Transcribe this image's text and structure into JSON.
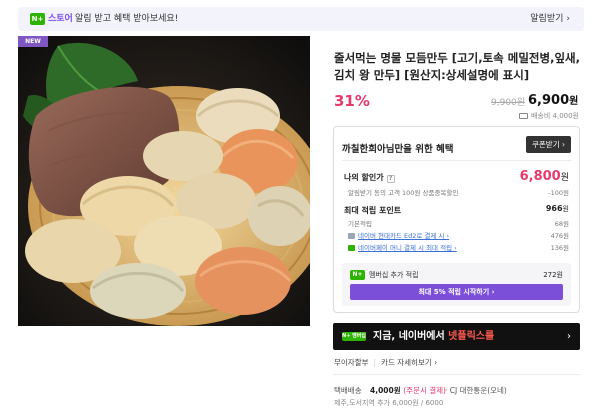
{
  "notice": {
    "badge": "N+",
    "store": "스토어",
    "message": "알림 받고 혜택 받아보세요!",
    "button": "알림받기",
    "chevron": "›"
  },
  "product": {
    "new_tag": "NEW",
    "title": "줄서먹는 명물 모듬만두 [고기,토속 메밀전병,잎새,김치 왕 만두] [원산지:상세설명에 표시]",
    "discount": "31%",
    "original_price": "9,900원",
    "price": "6,900",
    "price_unit": "원",
    "shipping": "배송비 4,000원"
  },
  "benefits": {
    "heading": "까칠한희아님만을 위한 혜택",
    "coupon_button": "쿠폰받기 ›",
    "my_price_label": "나의 할인가",
    "help_icon": "?",
    "my_price": "6,800",
    "my_price_unit": "원",
    "alarm_note": "알림받기 동의 고객 100원 상품중복할인",
    "alarm_value": "-100원",
    "points_label": "최대 적립 포인트",
    "points_total": "966",
    "points_unit": "원",
    "basic_label": "기본적립",
    "basic_value": "68원",
    "hyundai_label": "네이버 현대카드 Ed2로 결제 시 ›",
    "hyundai_value": "476원",
    "pay_label": "네이버페이 머니 결제 시 최대 적립 ›",
    "pay_value": "136원",
    "membership_badge": "N+",
    "membership_label": "멤버십 추가 적립",
    "membership_value": "272원",
    "membership_button": "최대 5% 적립 시작하기 ›"
  },
  "banner": {
    "badge": "N+ 멤버십",
    "text_prefix": "지금, ",
    "text_highlight_1": "네이버에서 ",
    "text_highlight_2": "넷플릭스를",
    "chevron": "›"
  },
  "links": {
    "installment": "무이자할부",
    "card_info": "카드 자세히보기 ›"
  },
  "shipping": {
    "label": "택배배송",
    "cost": "4,000원",
    "condition": "(주문시 결제)",
    "carrier": "· CJ 대한통운(오네)",
    "extra": "제주,도서지역 추가 6,000원 / 6000"
  },
  "colors": {
    "brand_green": "#2db400",
    "accent_pink": "#e53a6c",
    "membership_purple": "#7b4fd8",
    "notice_bg": "#f3f3fb"
  }
}
